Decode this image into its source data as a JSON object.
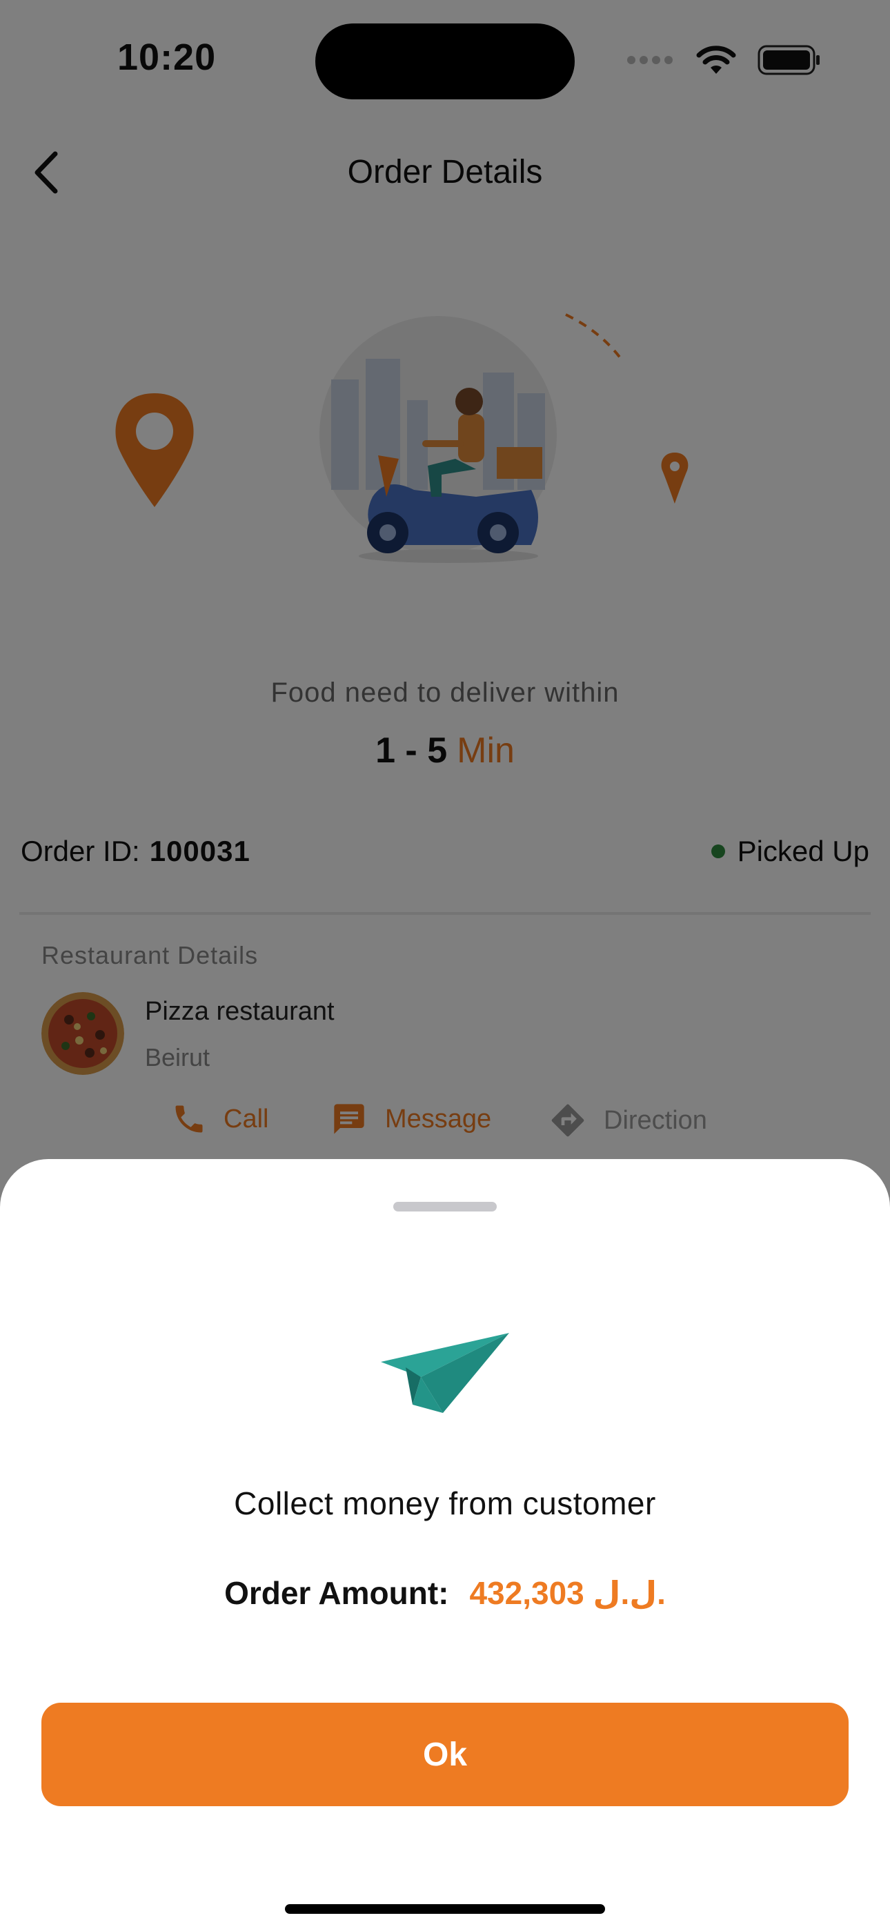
{
  "status_bar": {
    "time": "10:20"
  },
  "header": {
    "title": "Order Details"
  },
  "delivery": {
    "text": "Food need to deliver within",
    "eta_value": "1 - 5",
    "eta_unit": "Min"
  },
  "order": {
    "id_label": "Order ID:",
    "id_value": "100031",
    "status": "Picked Up",
    "status_color": "#2e8b3f"
  },
  "restaurant": {
    "section_label": "Restaurant Details",
    "name": "Pizza restaurant",
    "city": "Beirut",
    "actions": [
      {
        "label": "Call",
        "icon": "phone-icon"
      },
      {
        "label": "Message",
        "icon": "message-icon"
      },
      {
        "label": "Direction",
        "icon": "direction-icon"
      }
    ]
  },
  "sheet": {
    "icon": "paper-plane-icon",
    "title": "Collect money from customer",
    "amount_label": "Order Amount:",
    "amount_value": "432,303 ل.ل.",
    "ok_label": "Ok"
  },
  "colors": {
    "accent": "#ee7b22",
    "plane": "#24958a",
    "overlay": "rgba(0,0,0,0.5)"
  }
}
